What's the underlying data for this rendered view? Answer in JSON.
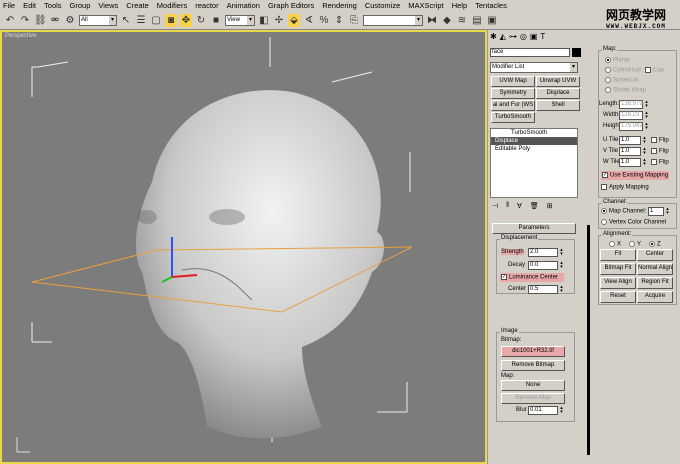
{
  "menu": [
    "File",
    "Edit",
    "Tools",
    "Group",
    "Views",
    "Create",
    "Modifiers",
    "reactor",
    "Animation",
    "Graph Editors",
    "Rendering",
    "Customize",
    "MAXScript",
    "Help",
    "Tentacles"
  ],
  "toolbar": {
    "selection_filter": "All",
    "coord_system": "View",
    "named_selection": ""
  },
  "watermark": {
    "text": "网页教学网",
    "url": "WWW.WEBJX.COM"
  },
  "viewport": {
    "label": "Perspective"
  },
  "command_panel": {
    "object_name": "face",
    "object_color": "#000000",
    "modifier_list": "Modifier List",
    "modifier_buttons": [
      "UVW Map",
      "Unwrap UVW",
      "Symmetry",
      "Displace",
      "ai and Fur (WS",
      "Shell",
      "TurboSmooth"
    ],
    "stack": [
      {
        "name": "TurboSmooth",
        "selected": false
      },
      {
        "name": "Displace",
        "selected": true
      },
      {
        "name": "Editable Poly",
        "selected": false
      }
    ],
    "rollout": "Parameters",
    "displacement": {
      "title": "Displacement",
      "strength_label": "Strength",
      "strength": "2.0",
      "decay_label": "Decay",
      "decay": "0.0",
      "luminance_center": "Luminance Center",
      "luminance_checked": true,
      "center_label": "Center",
      "center": "0.5"
    },
    "image": {
      "title": "Image",
      "bitmap_label": "Bitmap:",
      "bitmap": "dic1001+R32.tif",
      "remove_bitmap": "Remove Bitmap",
      "map_label": "Map:",
      "map": "None",
      "remove_map": "Remove Map",
      "blur_label": "Blur",
      "blur": "0.01"
    }
  },
  "map_panel": {
    "title": "Map:",
    "types": [
      "Planar",
      "Cylindrical",
      "Spherical",
      "Shrink Wrap"
    ],
    "cap": "Cap",
    "length_label": "Length:",
    "length": "138.979",
    "width_label": "Width:",
    "width": "126.23",
    "height_label": "Height:",
    "height": "175.042",
    "tiles": [
      {
        "label": "U Tile",
        "value": "1.0"
      },
      {
        "label": "V Tile",
        "value": "1.0"
      },
      {
        "label": "W Tile",
        "value": "1.0"
      }
    ],
    "flip": "Flip",
    "use_existing": "Use Existing Mapping",
    "apply_mapping": "Apply Mapping",
    "channel_title": "Channel:",
    "map_channel": "Map Channel:",
    "map_channel_value": "1",
    "vertex_color": "Vertex Color Channel",
    "alignment_title": "Alignment:",
    "axes": [
      "X",
      "Y",
      "Z"
    ],
    "selected_axis": "Z",
    "align_buttons": [
      "Fit",
      "Center",
      "Bitmap Fit",
      "Normal Align",
      "View Align",
      "Region Fit",
      "Reset",
      "Acquire"
    ]
  }
}
